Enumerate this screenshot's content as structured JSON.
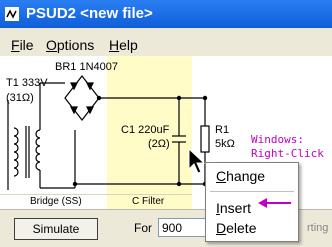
{
  "window": {
    "title": "PSUD2  <new file>"
  },
  "menu": [
    {
      "accel": "F",
      "rest": "ile"
    },
    {
      "accel": "O",
      "rest": "ptions"
    },
    {
      "accel": "H",
      "rest": "elp"
    }
  ],
  "schematic": {
    "rectifier_label": "BR1 1N4007",
    "transformer_label": "T1 333V",
    "transformer_resistance": "(31Ω)",
    "capacitor_label": "C1 220uF",
    "capacitor_resistance": "(2Ω)",
    "resistor_name": "R1",
    "resistor_value": "5kΩ",
    "bridge_section_label": "Bridge (SS)",
    "filter_section_label": "C Filter"
  },
  "annotation": {
    "line1": "Windows:",
    "line2": "Right-Click"
  },
  "context_menu": {
    "change": {
      "accel": "C",
      "rest": "hange"
    },
    "insert": {
      "accel": "I",
      "rest": "nsert"
    },
    "delete": {
      "accel": "D",
      "rest": "elete"
    }
  },
  "controls": {
    "simulate_label": "Simulate",
    "for_label": "For",
    "for_value": "900",
    "starting_text": "rting dela"
  },
  "colors": {
    "title_bar": "#0e5ed8",
    "filter_band": "#fffcc8",
    "annotation": "#c000c0"
  }
}
